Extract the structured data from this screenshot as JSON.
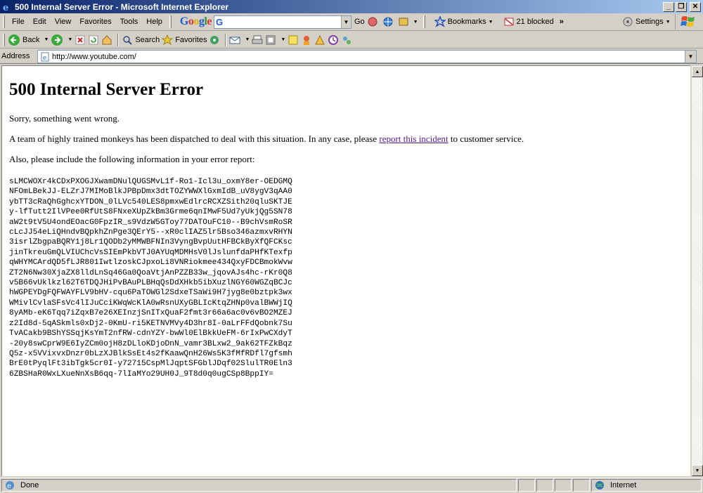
{
  "window": {
    "title": "500 Internal Server Error - Microsoft Internet Explorer",
    "minimize": "_",
    "maximize": "❐",
    "close": "✕"
  },
  "menu": {
    "items": [
      "File",
      "Edit",
      "View",
      "Favorites",
      "Tools",
      "Help"
    ]
  },
  "google_toolbar": {
    "logo": "Google",
    "search_prefix": "G",
    "search_value": "",
    "go_label": "Go",
    "bookmarks_label": "Bookmarks",
    "blocked_label": "21 blocked",
    "more": "»",
    "settings_label": "Settings"
  },
  "buttons": {
    "back": "Back",
    "search": "Search",
    "favorites": "Favorites"
  },
  "address": {
    "label": "Address",
    "url": "http://www.youtube.com/"
  },
  "page": {
    "heading": "500 Internal Server Error",
    "sorry": "Sorry, something went wrong.",
    "team_before": "A team of highly trained monkeys has been dispatched to deal with this situation. In any case, please ",
    "report_link": "report this incident",
    "team_after": " to customer service.",
    "include": "Also, please include the following information in your error report:",
    "error_report": "sLMCWOXr4kCDxPXOGJXwamDNulQUGSMvL1f-Ro1-Icl3u_oxmY8er-OEDGMQ\nNFOmLBekJJ-ELZrJ7MIMoBlkJPBpDmx3dtTOZYWWXlGxmIdB_uV8ygV3qAA0\nybTT3cRaQhGghcxYTDON_0lLVc540LES8pmxwEdlrcRCXZSith20qluSKTJE\ny-lfTutt2IlVPee0RfUtS8FNxeXUpZkBm3Grme6qnIMwF5Ud7yUkjQg5SN78\naW2t9tV5U4ondEOacG0FpzIR_s9VdzW5GToy77DATOuFC10--B9chVsmRoSR\ncLcJJ54eLiQHndvBQpkhZnPge3QErY5--xR0clIAZ5lr5Bso346azmxvRHYN\n3isrlZbgpaBQRY1j8Lr1QODb2yMMWBFNIn3VyngBvpUutHFBCkByXfQFCKsc\njinTkreuGmQLVIUChcVsSIEmPkbVTJ0AYUqMDMHsV0lJslunfdaPHfKTexfp\nqWHYMCArdQD5fLJR801IwtlzoskCJpxoLi8VNRiokmee434QxyFDCBmokWvw\nZT2N6Nw30XjaZX8lldLnSq46Ga0QoaVtjAnPZZB33w_jqovAJs4hc-rKr0Q8\nv5B66vUklkzl62T6TDQJHiPvBAuPLBHqQsDdXHkb5ibXuzlNGY60WGZqBCJc\nhWGPEYDgFQFWAYFLV9bHV-cqu6PaTOWGl2SdxeTSaWi9H7jyg8e0bztpk3wx\nWMivlCvlaSFsVc4lIJuCciKWqWcKlA0wRsnUXyGBLIcKtqZHNp0valBWWjIQ\n8yAMb-eK6Tqq7iZqxB7e26XEInzjSnITxQuaF2fmt3r66a6ac0v6vBO2MZEJ\nz2Id8d-5qASkmls0xDj2-0KmU-ri5KETNVMVy4D3hr8I-0aLrFFdQobnk7Su\nTvACakb9BShYSSqjKsYmT2nfRW-cdnYZY-bwWl0ElBkkUeFM-6rIxPwCXdyT\n-20y8swCprW9E6IyZCm0ojH8zDLloKDjoDnN_vamr3BLxw2_9ak62TFZkBqz\nQ5z-x5VVixvxDnzr0bLzXJBlkSsEt4s2fKaawQnH26Ws5K3fMfRDfl7gfsmh\nBrE0tPyqlFt3ibTgk5cr0I-y72715CspMlJqptSFGblJDqf02SlulTR0Eln3\n6ZBSHaR0WxLXueNnXsB6qq-7lIaMYo29UH0J_9T8d0q0ugCSp8BppIY="
  },
  "status": {
    "text": "Done",
    "zone": "Internet"
  }
}
